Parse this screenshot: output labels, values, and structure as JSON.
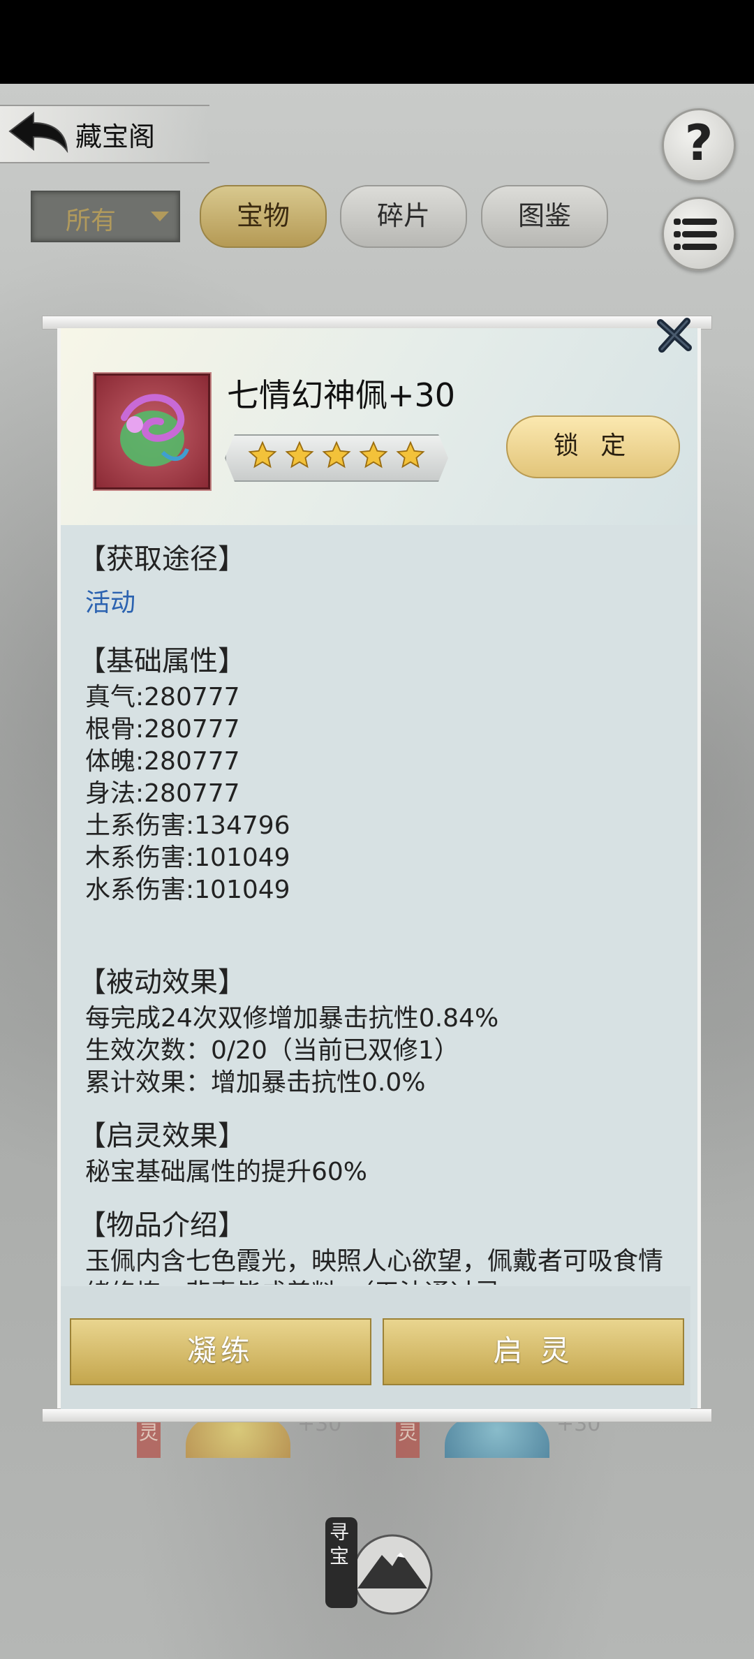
{
  "header": {
    "title": "藏宝阁",
    "help_label": "?"
  },
  "filter": {
    "selected": "所有"
  },
  "tabs": [
    {
      "label": "宝物",
      "active": true
    },
    {
      "label": "碎片",
      "active": false
    },
    {
      "label": "图鉴",
      "active": false
    }
  ],
  "item": {
    "name": "七情幻神佩+30",
    "stars": 5,
    "lock_label": "锁 定",
    "icon": "dragon-pendant-icon"
  },
  "details": {
    "source_title": "【获取途径】",
    "source_link": "活动",
    "base_title": "【基础属性】",
    "base_attrs": [
      "真气:280777",
      "根骨:280777",
      "体魄:280777",
      "身法:280777",
      "土系伤害:134796",
      "木系伤害:101049",
      "水系伤害:101049"
    ],
    "passive_title": "【被动效果】",
    "passive_lines": [
      "每完成24次双修增加暴击抗性0.84%",
      "生效次数：0/20（当前已双修1）",
      "累计效果：增加暴击抗性0.0%"
    ],
    "awaken_title": "【启灵效果】",
    "awaken_lines": [
      "秘宝基础属性的提升60%"
    ],
    "intro_title": "【物品介绍】",
    "intro_text": "玉佩内含七色霞光，映照人心欲望，佩戴者可吸食情绪修炼，悲喜皆成养料。（无法通过灵"
  },
  "actions": {
    "refine_label": "凝练",
    "awaken_label": "启 灵"
  },
  "background": {
    "card1_tag": "灵",
    "card1_plus": "+30",
    "card2_tag": "灵",
    "card2_plus": "+30",
    "seal_text": "寻宝"
  },
  "colors": {
    "accent_gold": "#c4a64d",
    "link_blue": "#2b62b0",
    "panel_bg": "#d7e1e3"
  }
}
